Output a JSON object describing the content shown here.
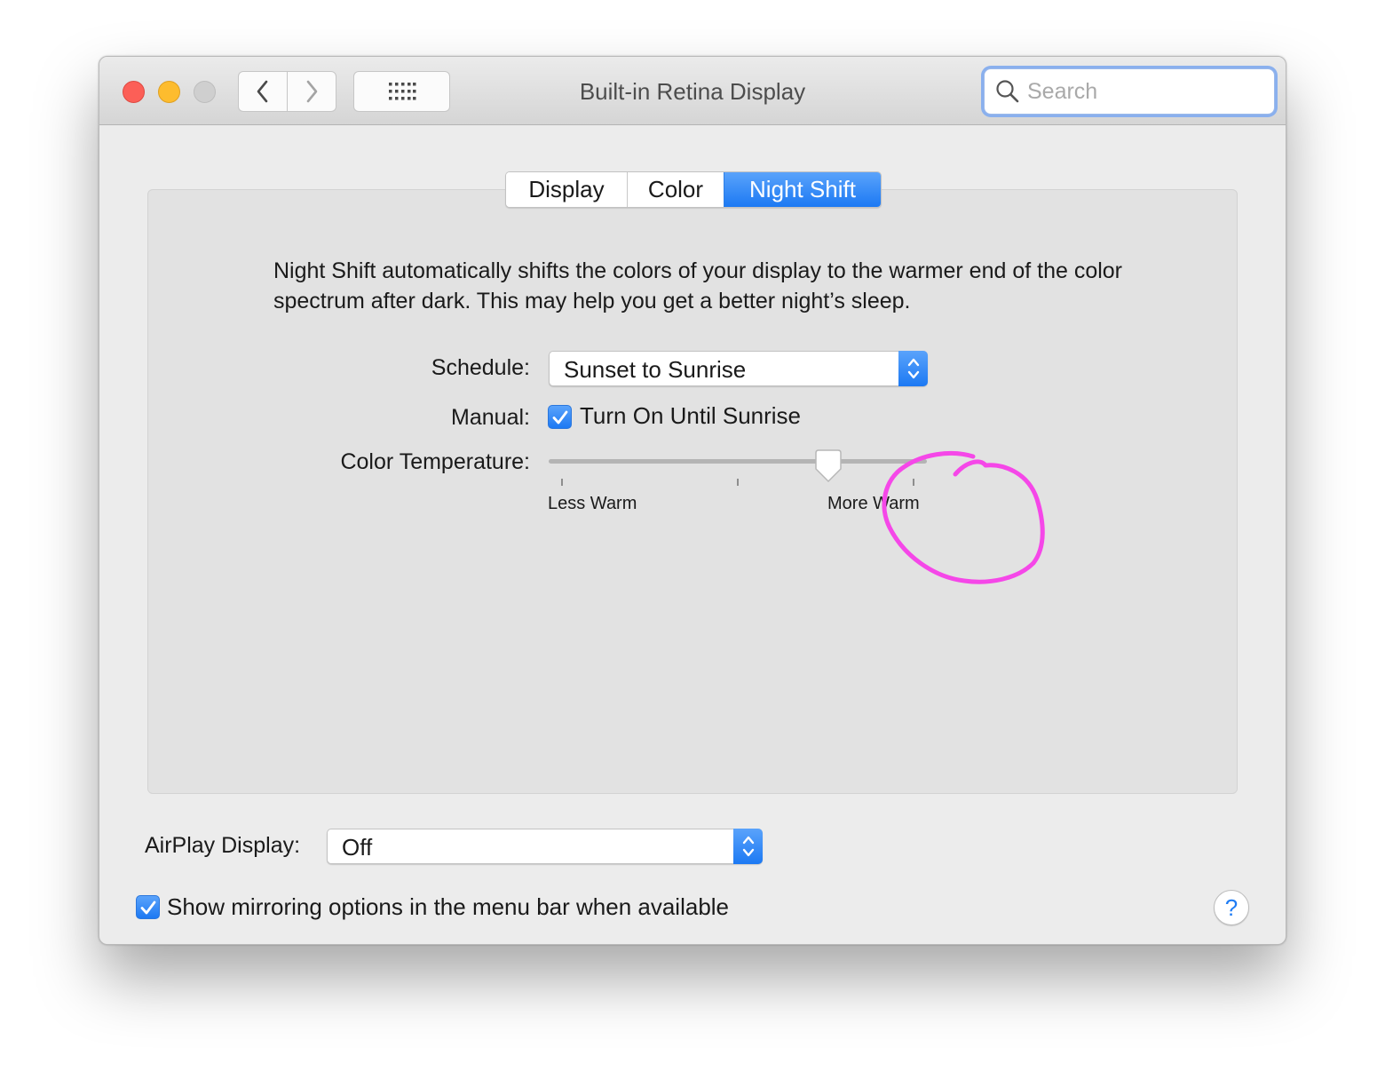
{
  "window": {
    "title": "Built-in Retina Display",
    "search_placeholder": "Search"
  },
  "tabs": [
    {
      "label": "Display",
      "active": false
    },
    {
      "label": "Color",
      "active": false
    },
    {
      "label": "Night Shift",
      "active": true
    }
  ],
  "night_shift": {
    "description": "Night Shift automatically shifts the colors of your display to the warmer end of the color spectrum after dark. This may help you get a better night’s sleep.",
    "schedule_label": "Schedule:",
    "schedule_value": "Sunset to Sunrise",
    "manual_label": "Manual:",
    "manual_checkbox_label": "Turn On Until Sunrise",
    "manual_checked": true,
    "color_temp_label": "Color Temperature:",
    "slider_min_label": "Less Warm",
    "slider_max_label": "More Warm",
    "slider_value_fraction": 0.74
  },
  "airplay": {
    "label": "AirPlay Display:",
    "value": "Off"
  },
  "mirroring": {
    "label": "Show mirroring options in the menu bar when available",
    "checked": true
  },
  "help_label": "?",
  "colors": {
    "accent": "#1c79f3",
    "annotation": "#f547e8",
    "close": "#fc5f57",
    "minimize": "#fdbc2e",
    "zoom_disabled": "#cfcfcf"
  }
}
